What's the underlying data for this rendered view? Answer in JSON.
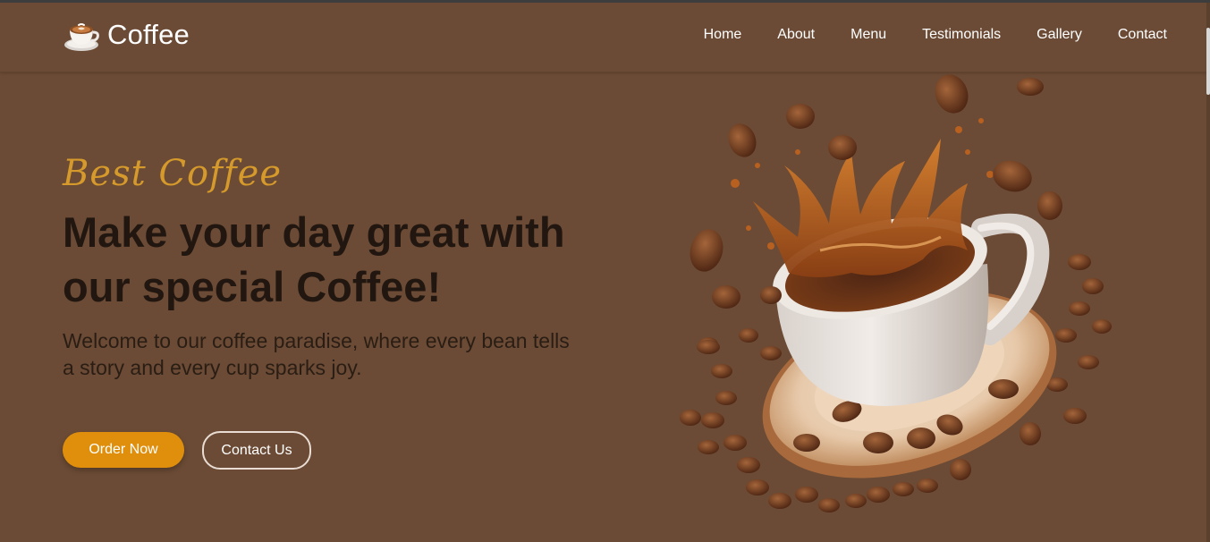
{
  "header": {
    "logo_text": "Coffee",
    "nav": [
      "Home",
      "About",
      "Menu",
      "Testimonials",
      "Gallery",
      "Contact"
    ]
  },
  "hero": {
    "tagline": "Best Coffee",
    "headline": "Make your day great with our special Coffee!",
    "subtitle_line1": "Welcome to our coffee paradise, where every bean tells",
    "subtitle_line2": "a story and every cup sparks joy.",
    "order_button": "Order Now",
    "contact_button": "Contact Us",
    "image": "coffee-cup-splash-with-beans"
  },
  "colors": {
    "background": "#6b4b35",
    "accent": "#e08f0c",
    "tagline": "#d59a2b",
    "headline": "#221710",
    "nav_text": "#ffffff"
  }
}
